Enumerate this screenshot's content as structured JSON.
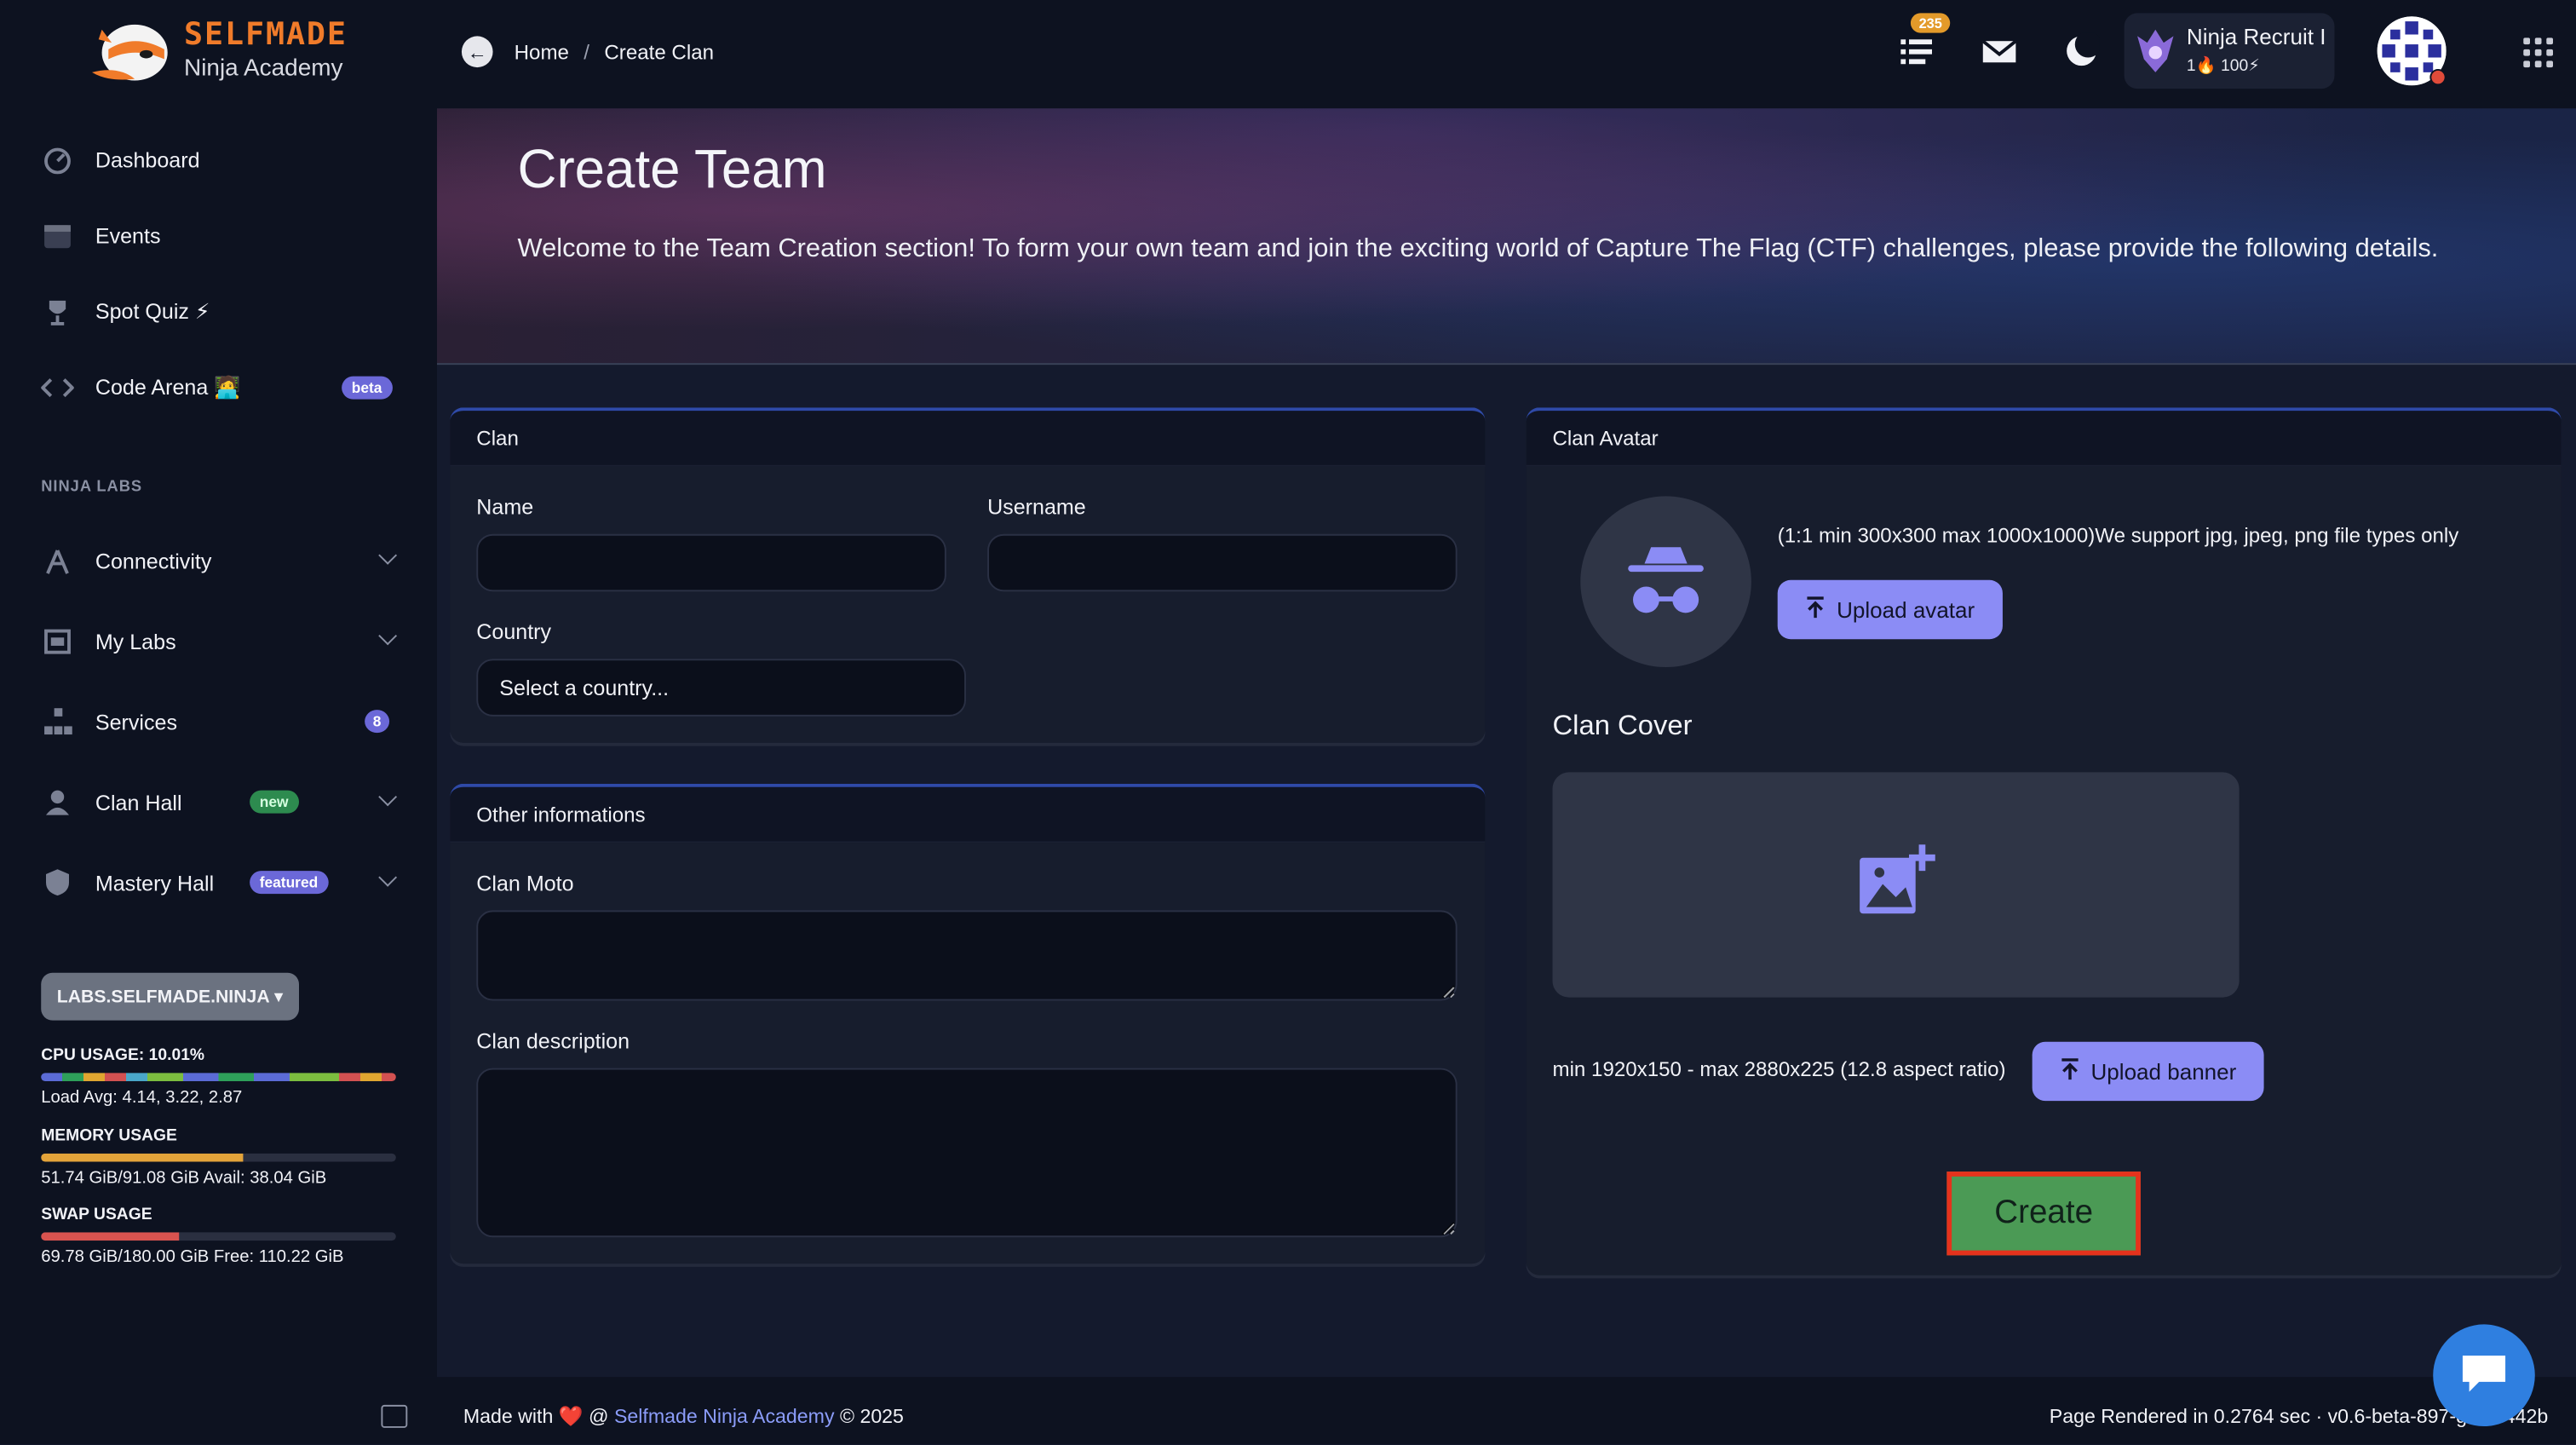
{
  "brand": {
    "name": "SELFMADE",
    "sub": "Ninja Academy"
  },
  "sidebar": {
    "items": [
      {
        "label": "Dashboard"
      },
      {
        "label": "Events"
      },
      {
        "label": "Spot Quiz ⚡"
      },
      {
        "label": "Code Arena 🧑‍💻",
        "badge": "beta"
      }
    ],
    "section": "NINJA LABS",
    "lab_items": [
      {
        "label": "Connectivity"
      },
      {
        "label": "My Labs"
      },
      {
        "label": "Services",
        "badge": "8"
      },
      {
        "label": "Clan Hall",
        "badge": "new"
      },
      {
        "label": "Mastery Hall",
        "badge": "featured"
      }
    ],
    "labs_button": "LABS.SELFMADE.NINJA ▾",
    "cpu": {
      "title": "CPU USAGE: 10.01%",
      "detail": "Load Avg: 4.14, 3.22, 2.87"
    },
    "memory": {
      "title": "MEMORY USAGE",
      "detail": "51.74 GiB/91.08 GiB Avail: 38.04 GiB",
      "fill": 0.57
    },
    "swap": {
      "title": "SWAP USAGE",
      "detail": "69.78 GiB/180.00 GiB Free: 110.22 GiB",
      "fill": 0.39
    }
  },
  "header": {
    "breadcrumb": [
      "Home",
      "Create Clan"
    ],
    "notif_count": "235",
    "profile_name": "Ninja Recruit I",
    "profile_stats": "1🔥 100⚡"
  },
  "hero": {
    "title": "Create Team",
    "text": "Welcome to the Team Creation section! To form your own team and join the exciting world of Capture The Flag (CTF) challenges, please provide the following details."
  },
  "clan_card": {
    "title": "Clan",
    "name_label": "Name",
    "username_label": "Username",
    "country_label": "Country",
    "country_placeholder": "Select a country..."
  },
  "other_card": {
    "title": "Other informations",
    "moto_label": "Clan Moto",
    "desc_label": "Clan description"
  },
  "avatar_card": {
    "title": "Clan Avatar",
    "hint": "(1:1 min 300x300 max 1000x1000)We support jpg, jpeg, png file types only",
    "upload_avatar": "Upload avatar",
    "cover_title": "Clan Cover",
    "cover_hint": "min 1920x150 - max 2880x225 (12.8 aspect ratio)",
    "upload_banner": "Upload banner",
    "create": "Create"
  },
  "footer": {
    "made_with": "Made with ❤️ @ ",
    "link": "Selfmade Ninja Academy",
    "year": " © 2025",
    "render": "Page Rendered in 0.2764 sec · v0.6-beta-897-gc2...442b"
  }
}
